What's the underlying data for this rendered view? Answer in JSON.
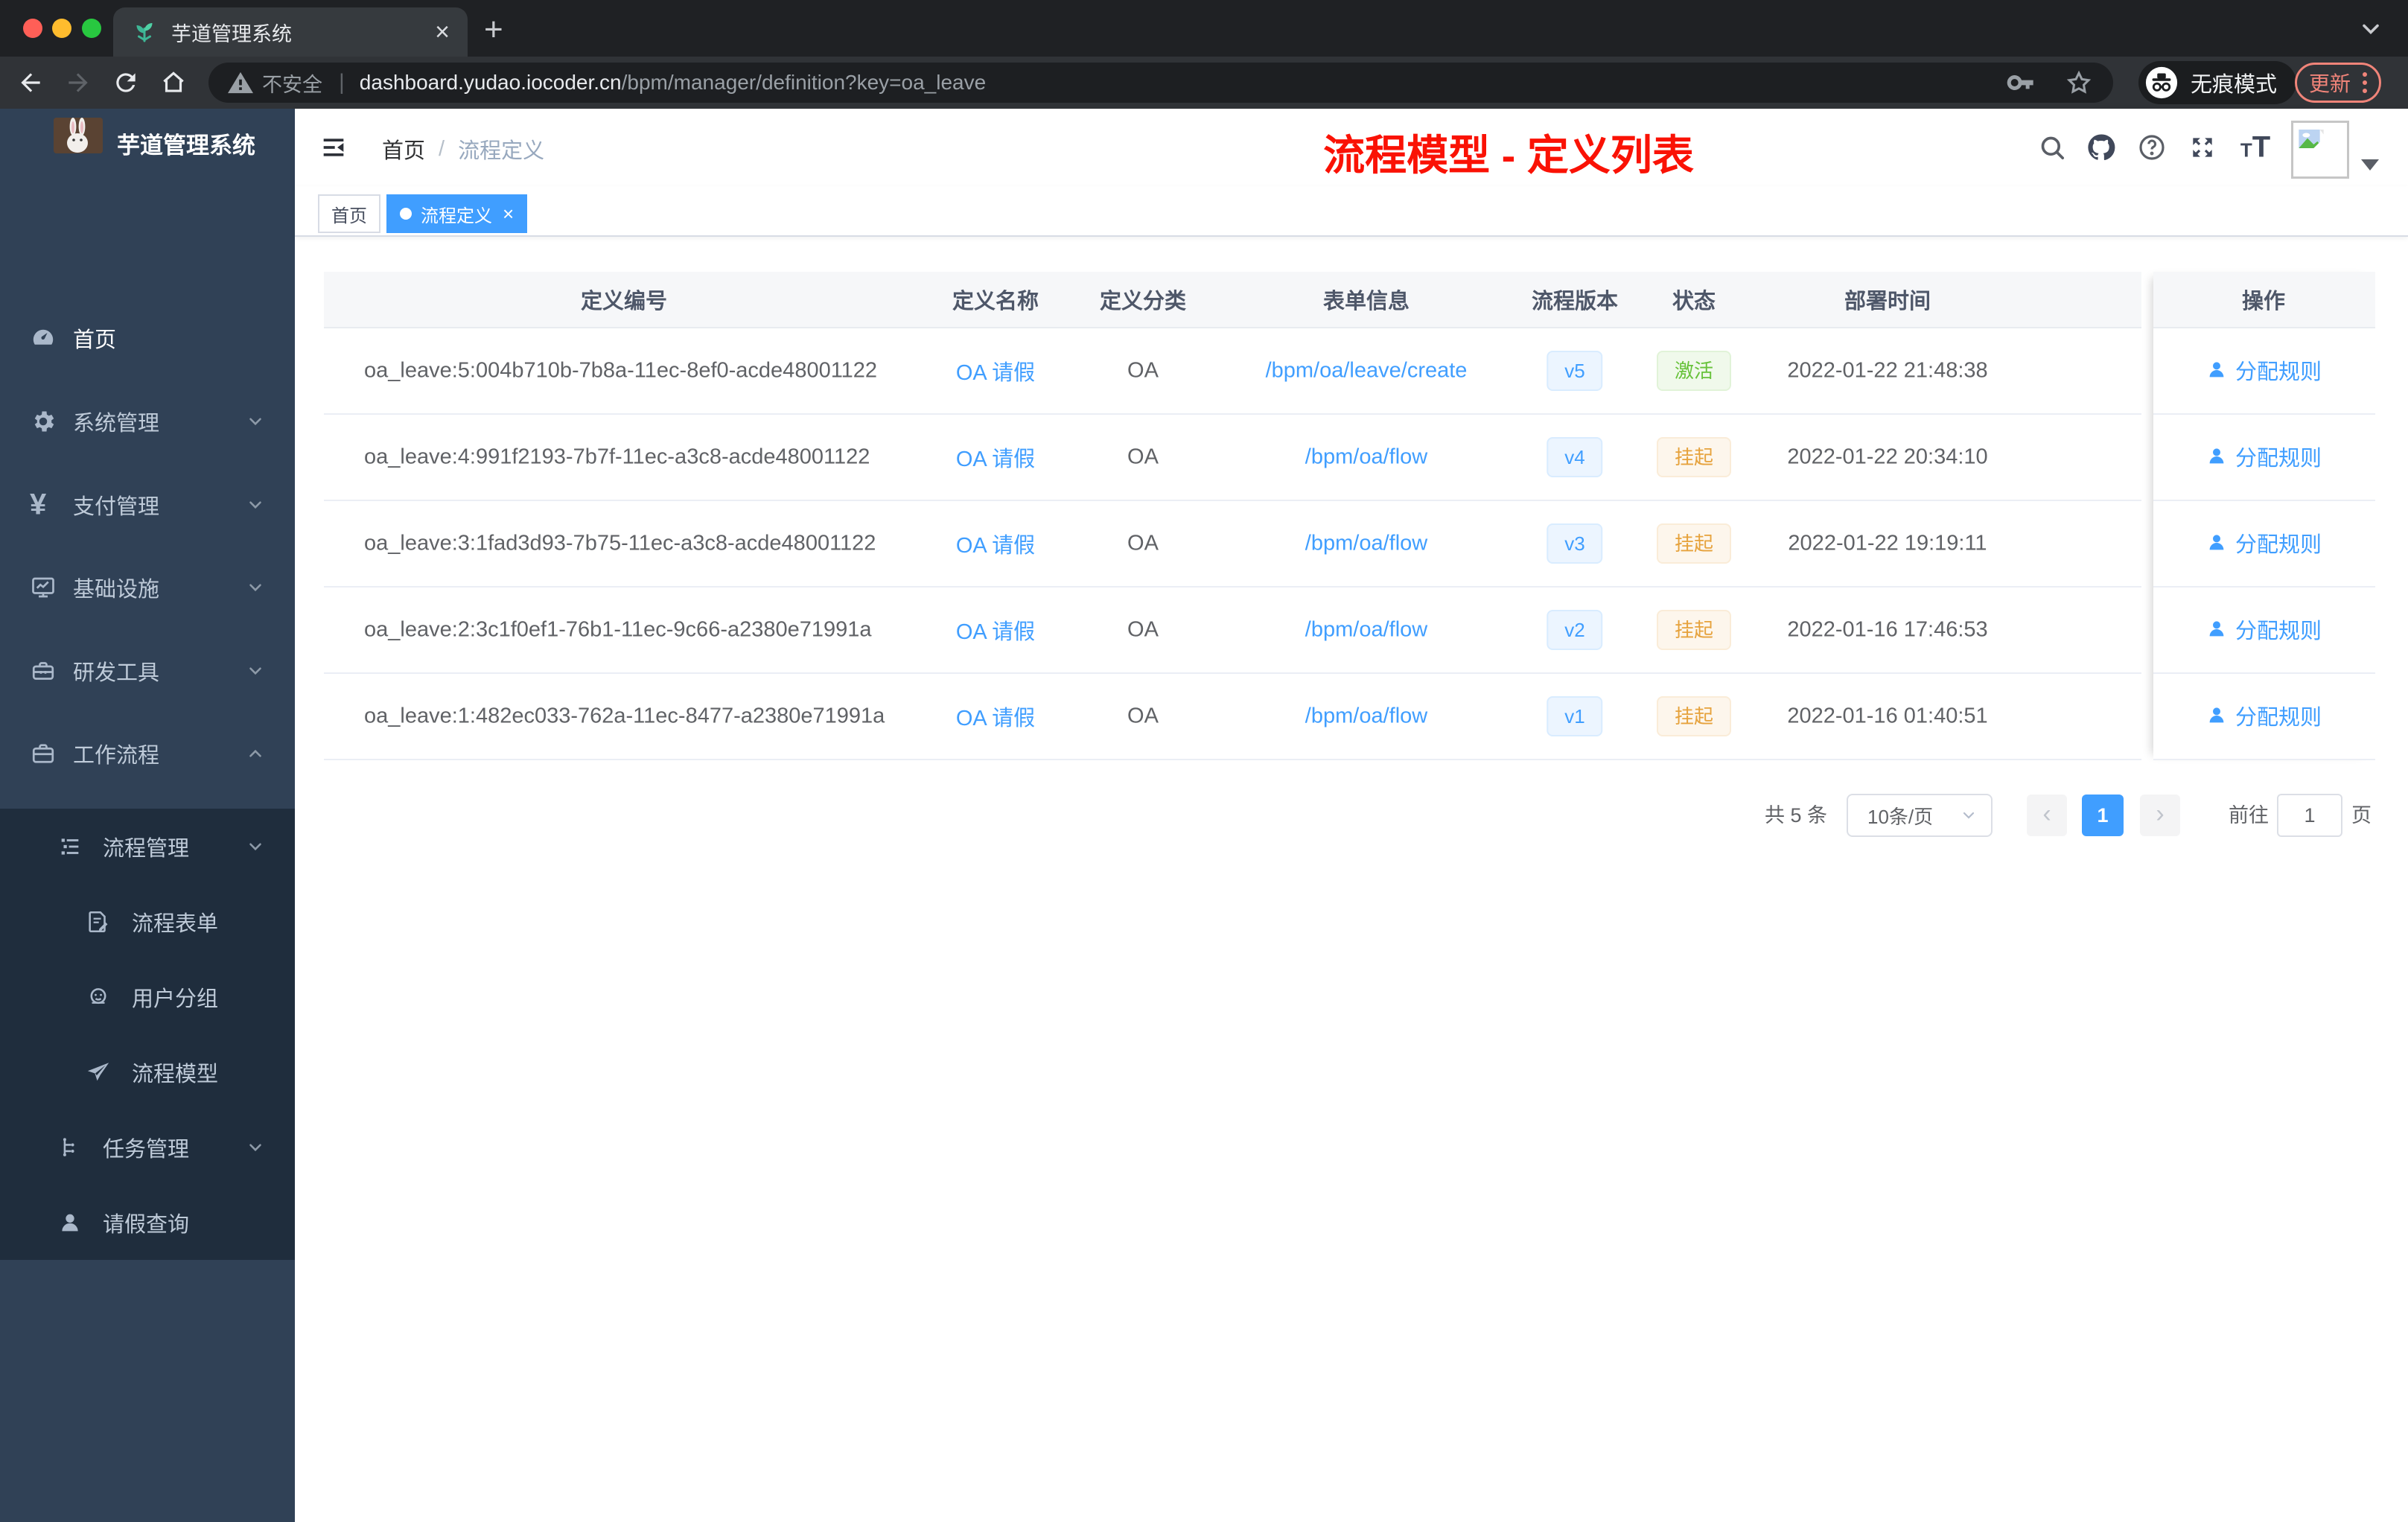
{
  "browser": {
    "tab": {
      "title": "芋道管理系统",
      "close_glyph": "×",
      "new_tab_glyph": "+"
    },
    "address": {
      "warning_label": "不安全",
      "separator": "|",
      "url_host": "dashboard.yudao.iocoder.cn",
      "url_path": "/bpm/manager/definition?key=oa_leave"
    },
    "incognito_label": "无痕模式",
    "update_label": "更新"
  },
  "sidebar": {
    "logo_title": "芋道管理系统",
    "items": [
      {
        "label": "首页",
        "icon": "dashboard-icon"
      },
      {
        "label": "系统管理",
        "icon": "gear-icon"
      },
      {
        "label": "支付管理",
        "icon": "yen-icon"
      },
      {
        "label": "基础设施",
        "icon": "monitor-icon"
      },
      {
        "label": "研发工具",
        "icon": "toolbox-icon"
      },
      {
        "label": "工作流程",
        "icon": "briefcase-icon"
      }
    ],
    "workflow_children": {
      "process_group": {
        "label": "流程管理",
        "children": [
          {
            "label": "流程表单",
            "icon": "form-icon"
          },
          {
            "label": "用户分组",
            "icon": "robot-icon"
          },
          {
            "label": "流程模型",
            "icon": "paper-plane-icon"
          }
        ]
      },
      "task_group": {
        "label": "任务管理"
      },
      "leave_item": {
        "label": "请假查询"
      }
    },
    "yen_glyph": "¥"
  },
  "header": {
    "breadcrumb": {
      "home": "首页",
      "separator": "/",
      "current": "流程定义"
    },
    "annotation": "流程模型 - 定义列表",
    "font_icon_small": "T",
    "font_icon_big": "T"
  },
  "tags": {
    "home": {
      "label": "首页"
    },
    "active": {
      "label": "流程定义",
      "close_glyph": "×"
    }
  },
  "table": {
    "columns": [
      "定义编号",
      "定义名称",
      "定义分类",
      "表单信息",
      "流程版本",
      "状态",
      "部署时间",
      "操作"
    ],
    "action_label": "分配规则",
    "rows": [
      {
        "id": "oa_leave:5:004b710b-7b8a-11ec-8ef0-acde48001122",
        "name": "OA 请假",
        "category": "OA",
        "form": "/bpm/oa/leave/create",
        "version": "v5",
        "status": "激活",
        "deployed_at": "2022-01-22 21:48:38"
      },
      {
        "id": "oa_leave:4:991f2193-7b7f-11ec-a3c8-acde48001122",
        "name": "OA 请假",
        "category": "OA",
        "form": "/bpm/oa/flow",
        "version": "v4",
        "status": "挂起",
        "deployed_at": "2022-01-22 20:34:10"
      },
      {
        "id": "oa_leave:3:1fad3d93-7b75-11ec-a3c8-acde48001122",
        "name": "OA 请假",
        "category": "OA",
        "form": "/bpm/oa/flow",
        "version": "v3",
        "status": "挂起",
        "deployed_at": "2022-01-22 19:19:11"
      },
      {
        "id": "oa_leave:2:3c1f0ef1-76b1-11ec-9c66-a2380e71991a",
        "name": "OA 请假",
        "category": "OA",
        "form": "/bpm/oa/flow",
        "version": "v2",
        "status": "挂起",
        "deployed_at": "2022-01-16 17:46:53"
      },
      {
        "id": "oa_leave:1:482ec033-762a-11ec-8477-a2380e71991a",
        "name": "OA 请假",
        "category": "OA",
        "form": "/bpm/oa/flow",
        "version": "v1",
        "status": "挂起",
        "deployed_at": "2022-01-16 01:40:51"
      }
    ]
  },
  "pagination": {
    "total": "共 5 条",
    "page_size": "10条/页",
    "prev_glyph": "‹",
    "next_glyph": "›",
    "current_page": "1",
    "goto_label": "前往",
    "goto_value": "1",
    "page_label": "页"
  },
  "colors": {
    "accent": "#409eff",
    "sidebar_bg": "#304156",
    "submenu_bg": "#1f2d3d",
    "success": "#67c23a",
    "warning": "#e6a23c",
    "annotation_red": "#fa1205",
    "update_salmon": "#f08479"
  }
}
